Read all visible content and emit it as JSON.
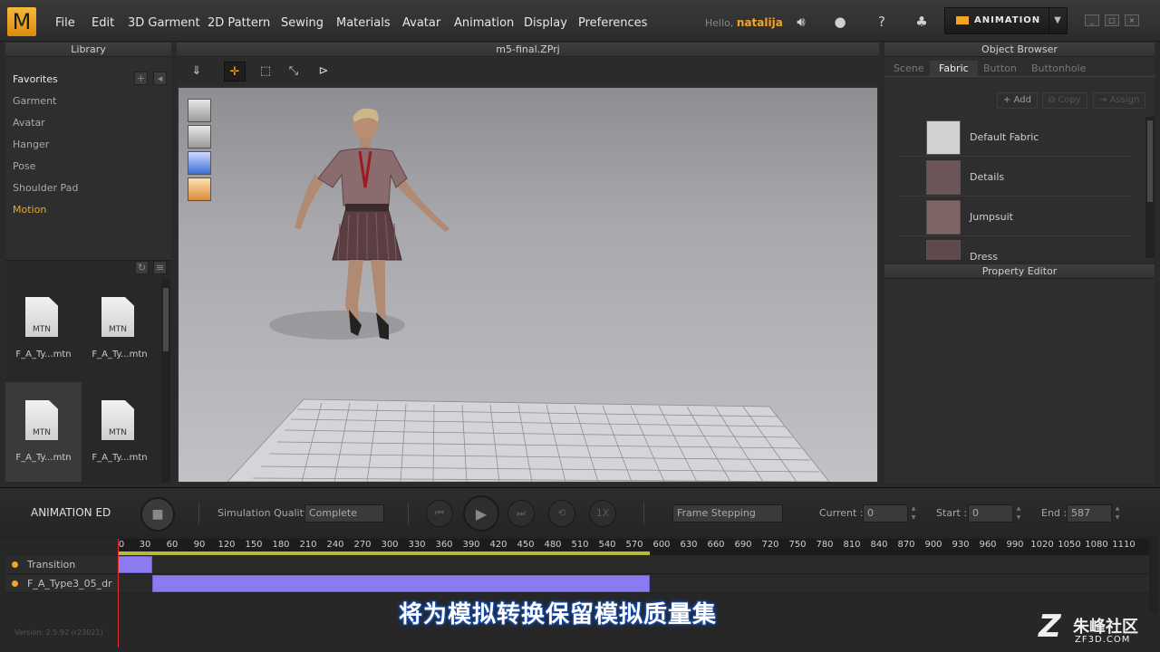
{
  "app": {
    "logo": "M",
    "file_title": "m5-final.ZPrj"
  },
  "menu": [
    "File",
    "Edit",
    "3D Garment",
    "2D Pattern",
    "Sewing",
    "Materials",
    "Avatar",
    "Animation",
    "Display",
    "Preferences"
  ],
  "user": {
    "greeting": "Hello,",
    "name": "natalija"
  },
  "mode_button": "ANIMATION",
  "library": {
    "title": "Library",
    "items": [
      "Favorites",
      "Garment",
      "Avatar",
      "Hanger",
      "Pose",
      "Shoulder Pad",
      "Motion"
    ],
    "active": "Motion",
    "files": [
      {
        "icon_text": "MTN",
        "name": "F_A_Ty...mtn"
      },
      {
        "icon_text": "MTN",
        "name": "F_A_Ty...mtn"
      },
      {
        "icon_text": "MTN",
        "name": "F_A_Ty...mtn"
      },
      {
        "icon_text": "MTN",
        "name": "F_A_Ty...mtn"
      }
    ]
  },
  "object_browser": {
    "title": "Object Browser",
    "tabs": [
      "Scene",
      "Fabric",
      "Button",
      "Buttonhole"
    ],
    "active_tab": "Fabric",
    "buttons": [
      "Add",
      "Copy",
      "Assign"
    ],
    "fabrics": [
      {
        "name": "Default Fabric",
        "color": "#d2d2d2"
      },
      {
        "name": "Details",
        "color": "#6b5556"
      },
      {
        "name": "Jumpsuit",
        "color": "#7e6465"
      },
      {
        "name": "Dress",
        "color": "#5e4a4b"
      }
    ]
  },
  "property_editor": {
    "title": "Property Editor"
  },
  "animation_editor": {
    "title": "ANIMATION ED",
    "simulation_quality_label": "Simulation Quality",
    "simulation_quality_value": "Complete",
    "speed": "1X",
    "frame_mode": "Frame Stepping",
    "current_label": "Current :",
    "current_value": "0",
    "start_label": "Start :",
    "start_value": "0",
    "end_label": "End :",
    "end_value": "587",
    "ruler_ticks": [
      "0",
      "30",
      "60",
      "90",
      "120",
      "150",
      "180",
      "210",
      "240",
      "270",
      "300",
      "330",
      "360",
      "390",
      "420",
      "450",
      "480",
      "510",
      "540",
      "570",
      "600",
      "630",
      "660",
      "690",
      "720",
      "750",
      "780",
      "810",
      "840",
      "870",
      "900",
      "930",
      "960",
      "990",
      "1020",
      "1050",
      "1080",
      "1110"
    ],
    "tracks": [
      {
        "name": "Transition",
        "clip_start": 0,
        "clip_end": 38
      },
      {
        "name": "F_A_Type3_05_dr",
        "clip_start": 38,
        "clip_end": 587
      }
    ],
    "version": "Version: 2.5.92   (r23021)"
  },
  "subtitle": "将为模拟转换保留模拟质量集",
  "watermark": {
    "brand": "朱峰社区",
    "site": "ZF3D.COM"
  }
}
